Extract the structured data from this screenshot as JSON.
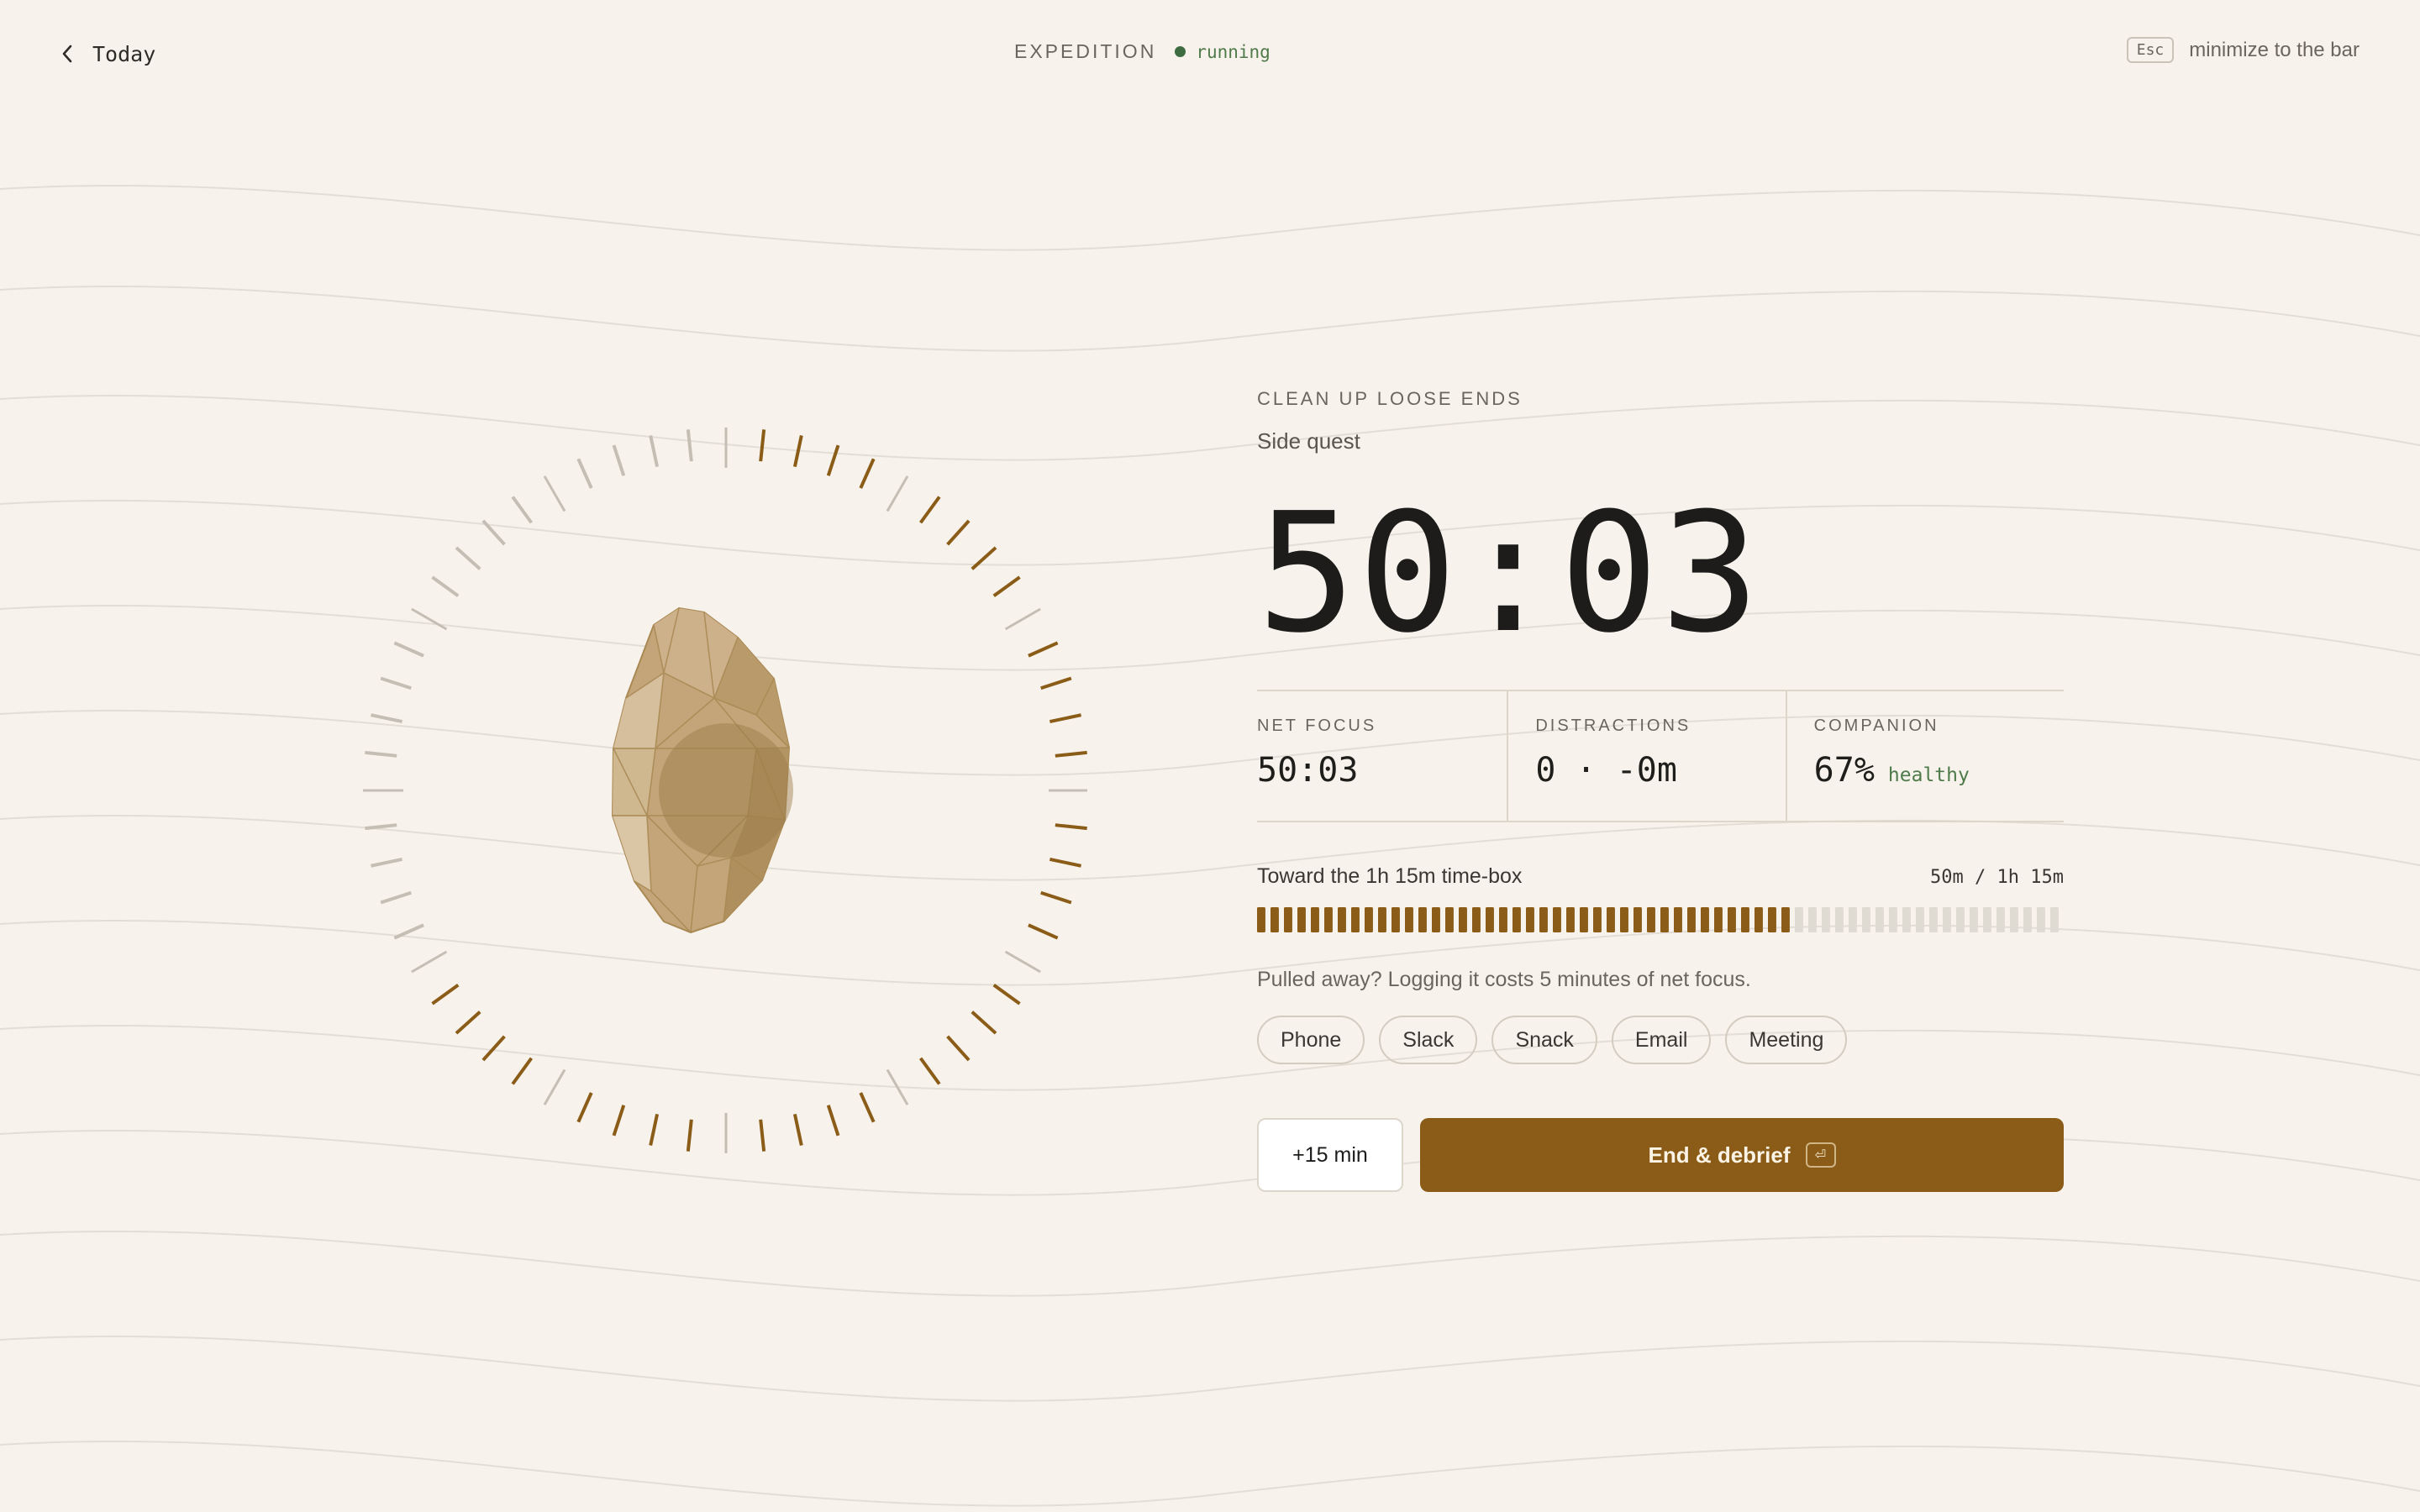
{
  "colors": {
    "background": "#f7f3ec",
    "accent": "#8a5c17",
    "tick_done": "#8a5c17",
    "tick_remaining": "#c4beb4",
    "healthy": "#4f7a4a",
    "running_dot": "#3e6b40",
    "progress_done": "#8a5c17",
    "progress_remaining": "#e0dbd2"
  },
  "header": {
    "back_label": "Today",
    "back_icon": "chevron-left-icon",
    "status_label": "EXPEDITION",
    "status_text": "running",
    "esc_key": "Esc",
    "esc_label": "minimize to the bar"
  },
  "dial": {
    "tick_count": 60,
    "elapsed_fraction": 0.667,
    "gem_icon": "crystal-gem-icon"
  },
  "quest": {
    "title": "CLEAN UP LOOSE ENDS",
    "subtitle": "Side quest"
  },
  "timer": "50:03",
  "stats": [
    {
      "label": "NET FOCUS",
      "value": "50:03",
      "sub": ""
    },
    {
      "label": "DISTRACTIONS",
      "value": "0 · -0m",
      "sub": ""
    },
    {
      "label": "COMPANION",
      "value": "67%",
      "sub": "healthy"
    }
  ],
  "progress": {
    "label": "Toward the 1h 15m time-box",
    "value_text": "50m / 1h 15m",
    "fraction": 0.667,
    "segments": 60
  },
  "distraction_prompt": "Pulled away? Logging it costs 5 minutes of net focus.",
  "chips": [
    "Phone",
    "Slack",
    "Snack",
    "Email",
    "Meeting"
  ],
  "actions": {
    "extend_label": "+15 min",
    "end_label": "End & debrief",
    "end_key": "⏎"
  }
}
